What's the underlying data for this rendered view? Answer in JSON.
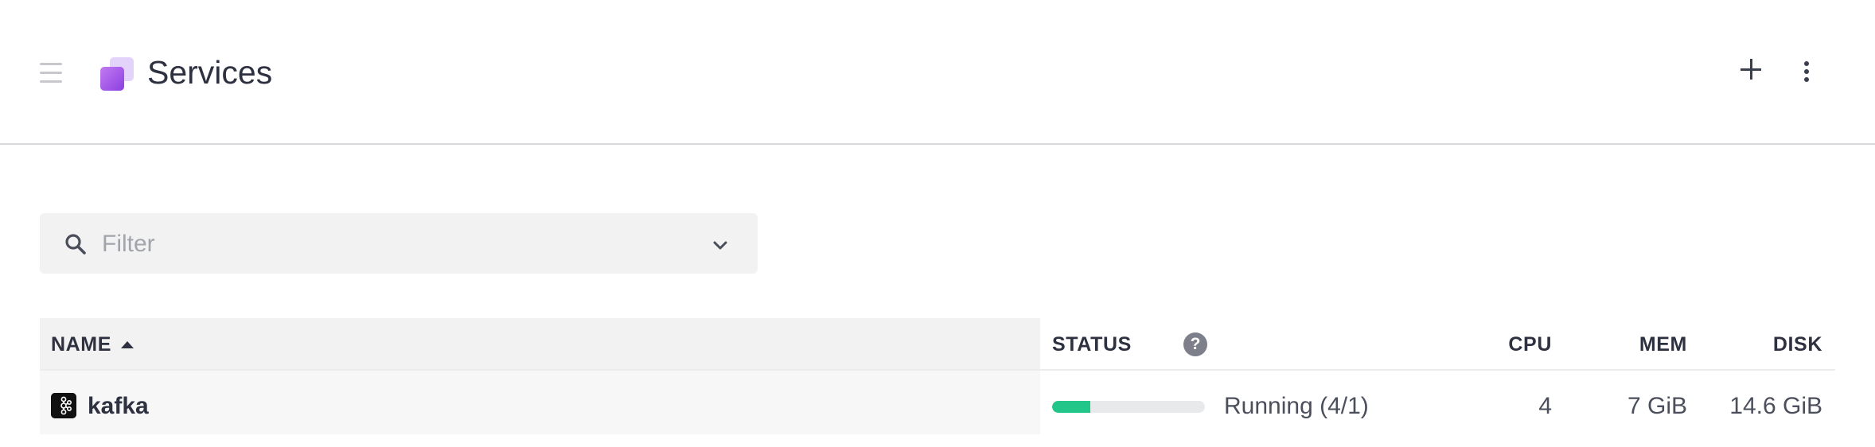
{
  "header": {
    "title": "Services",
    "menu_icon": "hamburger-menu-icon",
    "service_icon": "services-stack-icon",
    "add_icon": "plus-icon",
    "more_icon": "vertical-ellipsis-icon"
  },
  "filter": {
    "placeholder": "Filter",
    "value": "",
    "search_icon": "search-icon",
    "dropdown_icon": "chevron-down-icon"
  },
  "table": {
    "columns": {
      "name": "NAME",
      "status": "STATUS",
      "cpu": "CPU",
      "mem": "MEM",
      "disk": "DISK"
    },
    "sort": {
      "column": "name",
      "direction": "ascending",
      "icon": "sort-up-icon"
    },
    "status_help_icon": "help-icon",
    "help_symbol": "?",
    "rows": [
      {
        "icon": "kafka-logo-icon",
        "name": "kafka",
        "status": "Running (4/1)",
        "progress": 0.25,
        "cpu": "4",
        "mem": "7 GiB",
        "disk": "14.6 GiB"
      }
    ]
  },
  "colors": {
    "accent_purple": "#8c3fe0",
    "running_green": "#23c689",
    "text_dark": "#2d3140"
  }
}
